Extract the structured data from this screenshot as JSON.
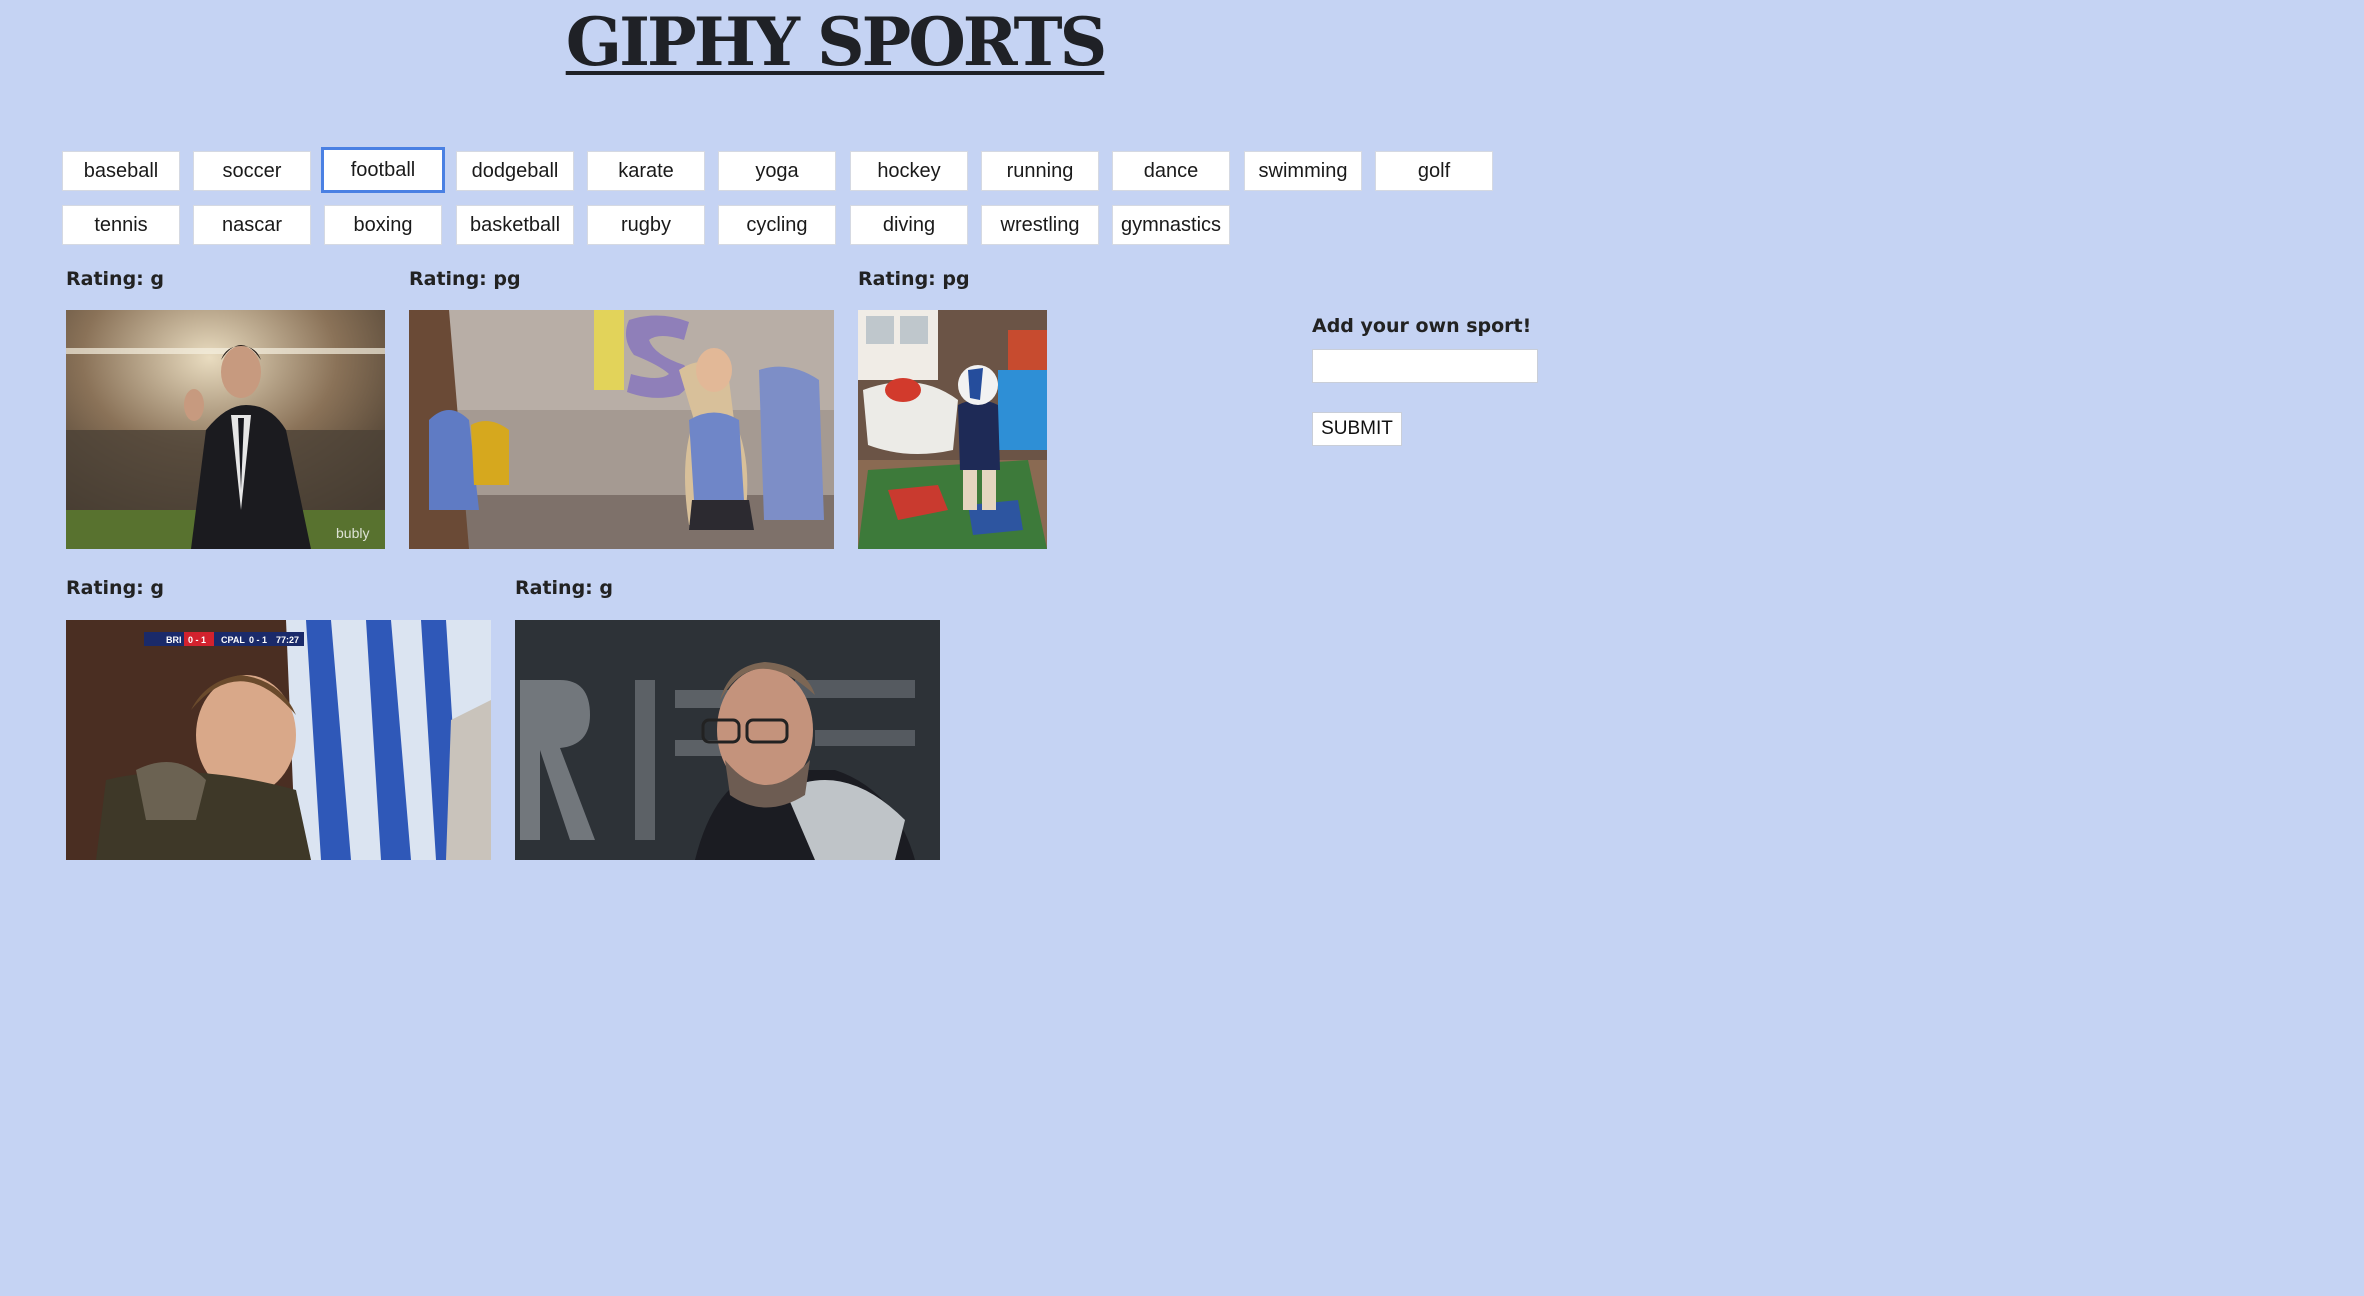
{
  "header": {
    "title": "GIPHY SPORTS"
  },
  "sports": {
    "row1": [
      "baseball",
      "soccer",
      "football",
      "dodgeball",
      "karate",
      "yoga",
      "hockey",
      "running",
      "dance",
      "swimming",
      "golf"
    ],
    "row2": [
      "tennis",
      "nascar",
      "boxing",
      "basketball",
      "rugby",
      "cycling",
      "diving",
      "wrestling",
      "gymnastics"
    ],
    "active": "football"
  },
  "gifs": [
    {
      "rating": "Rating: g"
    },
    {
      "rating": "Rating: pg"
    },
    {
      "rating": "Rating: pg"
    },
    {
      "rating": "Rating: g"
    },
    {
      "rating": "Rating: g"
    }
  ],
  "gif_overlays": {
    "watermark_1": "bubly",
    "scorebug_team_a": "BRI",
    "scorebug_score_a": "0 - 1",
    "scorebug_team_b": "CPAL",
    "scorebug_score_b": "0 - 1",
    "scorebug_clock": "77:27"
  },
  "add_sport": {
    "label": "Add your own sport!",
    "input_value": "",
    "input_placeholder": "",
    "submit_label": "SUBMIT"
  },
  "colors": {
    "background": "#c5d3f3",
    "focus_ring": "#4a80e3"
  }
}
